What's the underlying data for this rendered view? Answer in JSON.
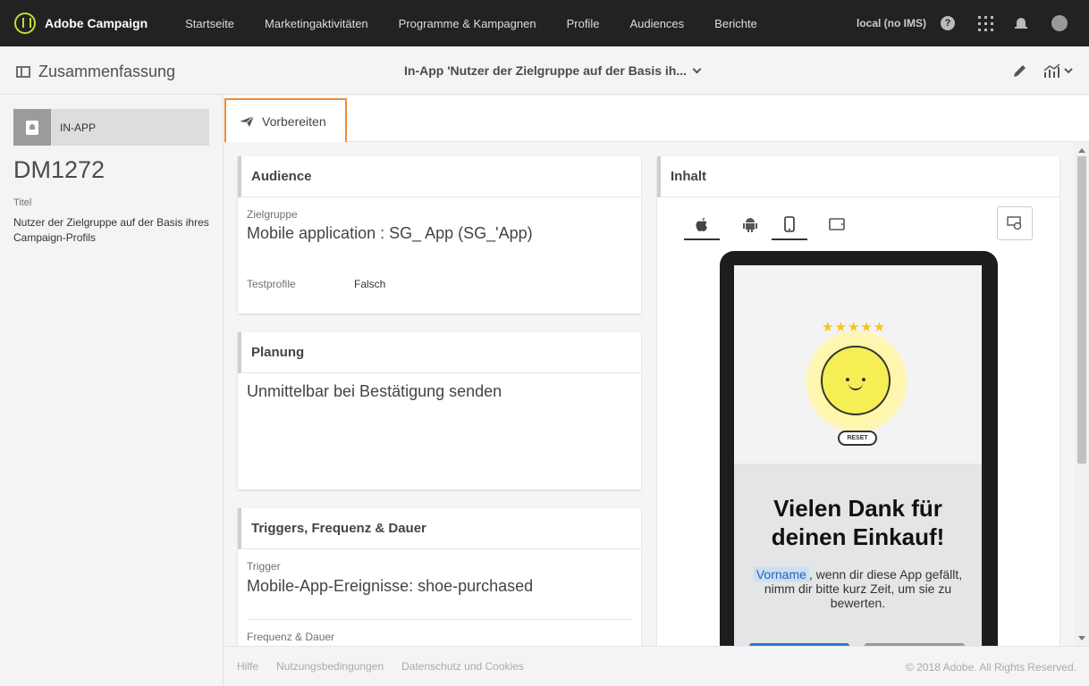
{
  "app": {
    "name": "Adobe Campaign"
  },
  "nav": [
    "Startseite",
    "Marketingaktivitäten",
    "Programme & Kampagnen",
    "Profile",
    "Audiences",
    "Berichte"
  ],
  "header": {
    "environment": "local (no IMS)",
    "help": "?"
  },
  "subbar": {
    "summary": "Zusammenfassung",
    "delivery_title": "In-App 'Nutzer der Zielgruppe auf der Basis ih..."
  },
  "left": {
    "channel": "IN-APP",
    "code": "DM1272",
    "title_label": "Titel",
    "title_value": "Nutzer der Zielgruppe auf der Basis ihres Campaign-Profils"
  },
  "actions": {
    "prepare": "Vorbereiten"
  },
  "audience": {
    "header": "Audience",
    "target_label": "Zielgruppe",
    "target_value": "Mobile application : SG_ App (SG_'App)",
    "test_label": "Testprofile",
    "test_value": "Falsch"
  },
  "planning": {
    "header": "Planung",
    "value": "Unmittelbar bei Bestätigung senden"
  },
  "triggers": {
    "header": "Triggers, Frequenz & Dauer",
    "trigger_label": "Trigger",
    "trigger_value": "Mobile-App-Ereignisse: shoe-purchased",
    "freq_label": "Frequenz & Dauer"
  },
  "content": {
    "header": "Inhalt",
    "device_tabs": [
      "ios-icon",
      "android-icon",
      "phone-icon",
      "tablet-icon"
    ],
    "active_tab": "phone-icon",
    "preview": {
      "stars": "★★★★★",
      "reset": "RESET",
      "headline": "Vielen Dank für deinen Einkauf!",
      "personalization": "Vorname",
      "message": ", wenn dir diese App gefällt, nimm dir bitte kurz Zeit, um sie zu bewerten."
    }
  },
  "footer": {
    "links": [
      "Hilfe",
      "Nutzungsbedingungen",
      "Datenschutz und Cookies"
    ],
    "copyright": "© 2018 Adobe. All Rights Reserved."
  },
  "colors": {
    "topbar": "#222222",
    "highlight": "#f08b32",
    "accent": "#2a7ad5"
  }
}
